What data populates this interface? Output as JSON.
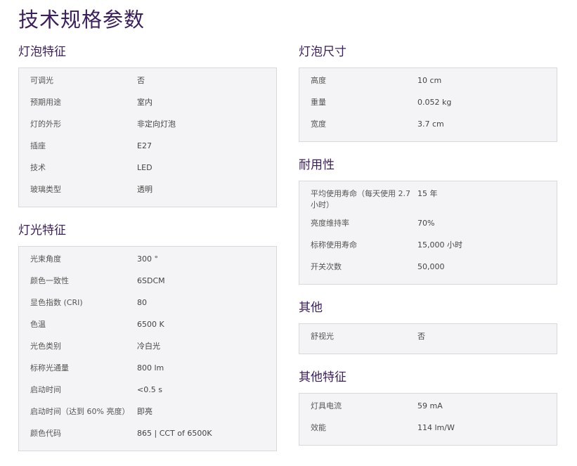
{
  "page": {
    "title": "技术规格参数"
  },
  "sections": {
    "bulb_features": {
      "title": "灯泡特征",
      "rows": [
        {
          "label": "可调光",
          "value": "否"
        },
        {
          "label": "预期用途",
          "value": "室内"
        },
        {
          "label": "灯的外形",
          "value": "非定向灯泡"
        },
        {
          "label": "插座",
          "value": "E27"
        },
        {
          "label": "技术",
          "value": "LED"
        },
        {
          "label": "玻璃类型",
          "value": "透明"
        }
      ]
    },
    "light_features": {
      "title": "灯光特征",
      "rows": [
        {
          "label": "光束角度",
          "value": "300 °"
        },
        {
          "label": "颜色一致性",
          "value": "6SDCM"
        },
        {
          "label": "显色指数 (CRI)",
          "value": "80"
        },
        {
          "label": "色温",
          "value": "6500 K"
        },
        {
          "label": "光色类别",
          "value": "冷白光"
        },
        {
          "label": "标称光通量",
          "value": "800 lm"
        },
        {
          "label": "启动时间",
          "value": "<0.5 s"
        },
        {
          "label": "启动时间（达到 60% 亮度）",
          "value": "即亮"
        },
        {
          "label": "颜色代码",
          "value": "865 | CCT of 6500K"
        }
      ]
    },
    "bulb_dimensions": {
      "title": "灯泡尺寸",
      "rows": [
        {
          "label": "高度",
          "value": "10 cm"
        },
        {
          "label": "重量",
          "value": "0.052 kg"
        },
        {
          "label": "宽度",
          "value": "3.7 cm"
        }
      ]
    },
    "durability": {
      "title": "耐用性",
      "rows": [
        {
          "label": "平均使用寿命（每天使用 2.7 小时）",
          "value": "15 年"
        },
        {
          "label": "亮度维持率",
          "value": "70%"
        },
        {
          "label": "标称使用寿命",
          "value": "15,000 小时"
        },
        {
          "label": "开关次数",
          "value": "50,000"
        }
      ]
    },
    "other": {
      "title": "其他",
      "rows": [
        {
          "label": "舒视光",
          "value": "否"
        }
      ]
    },
    "other_features": {
      "title": "其他特征",
      "rows": [
        {
          "label": "灯具电流",
          "value": "59 mA"
        },
        {
          "label": "效能",
          "value": "114 lm/W"
        }
      ]
    }
  }
}
